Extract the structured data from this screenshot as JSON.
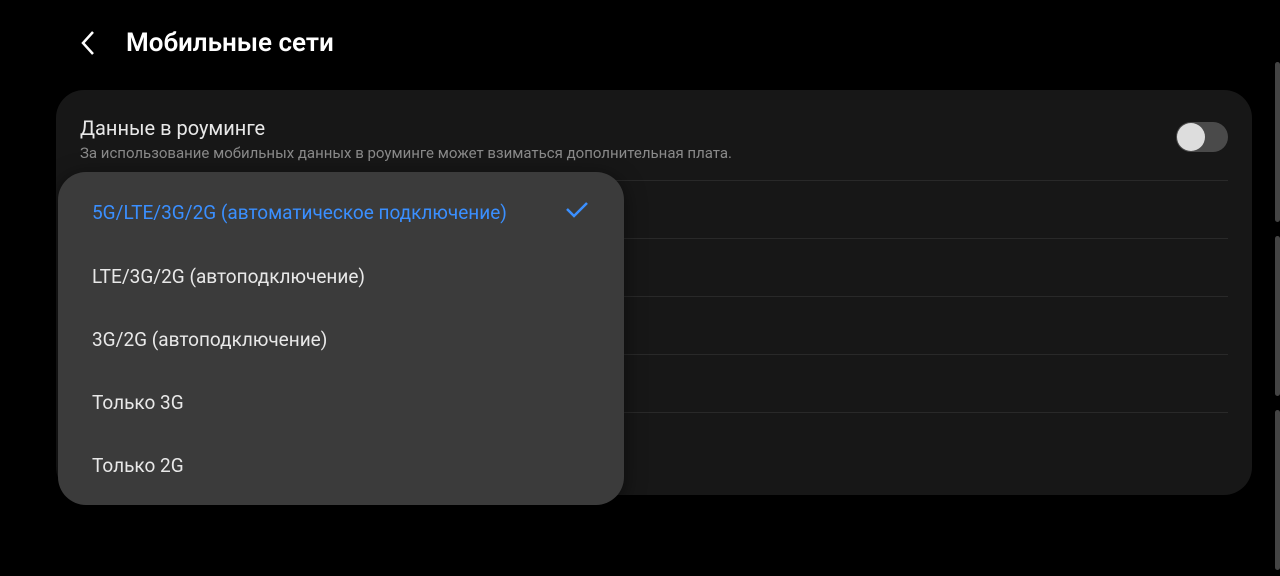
{
  "header": {
    "title": "Мобильные сети"
  },
  "settings": {
    "roaming": {
      "title": "Данные в роуминге",
      "desc": "За использование мобильных данных в роуминге может взиматься дополнительная плата."
    }
  },
  "popup": {
    "items": [
      {
        "label": "5G/LTE/3G/2G (автоматическое подключение)",
        "selected": true
      },
      {
        "label": "LTE/3G/2G (автоподключение)",
        "selected": false
      },
      {
        "label": "3G/2G (автоподключение)",
        "selected": false
      },
      {
        "label": "Только 3G",
        "selected": false
      },
      {
        "label": "Только 2G",
        "selected": false
      }
    ]
  }
}
